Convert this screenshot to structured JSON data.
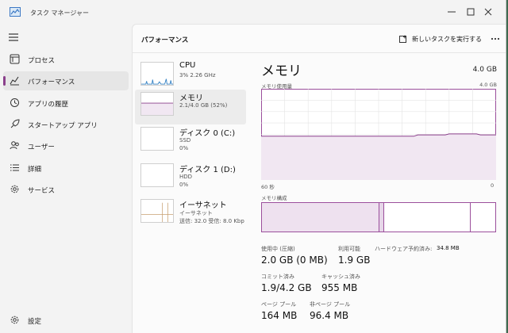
{
  "app": {
    "title": "タスク マネージャー"
  },
  "nav": {
    "items": [
      {
        "label": "プロセス",
        "icon": "process-grid-icon"
      },
      {
        "label": "パフォーマンス",
        "icon": "performance-icon",
        "active": true
      },
      {
        "label": "アプリの履歴",
        "icon": "history-icon"
      },
      {
        "label": "スタートアップ アプリ",
        "icon": "startup-icon"
      },
      {
        "label": "ユーザー",
        "icon": "users-icon"
      },
      {
        "label": "詳細",
        "icon": "details-list-icon"
      },
      {
        "label": "サービス",
        "icon": "services-gear-icon"
      }
    ],
    "settings_label": "設定"
  },
  "header": {
    "title": "パフォーマンス",
    "run_task_label": "新しいタスクを実行する"
  },
  "devices": [
    {
      "name": "CPU",
      "sub1": "3%  2.26 GHz",
      "sub2": "",
      "sub3": ""
    },
    {
      "name": "メモリ",
      "sub1": "2.1/4.0 GB (52%)",
      "sub2": "",
      "sub3": ""
    },
    {
      "name": "ディスク 0 (C:)",
      "sub1": "SSD",
      "sub2": "0%",
      "sub3": ""
    },
    {
      "name": "ディスク 1 (D:)",
      "sub1": "HDD",
      "sub2": "0%",
      "sub3": ""
    },
    {
      "name": "イーサネット",
      "sub1": "イーサネット",
      "sub2": "送信: 32.0  受信: 8.0 Kbp",
      "sub3": ""
    }
  ],
  "detail": {
    "title": "メモリ",
    "total": "4.0 GB",
    "usage_label": "メモリ使用量",
    "usage_max": "4.0 GB",
    "time_left": "60 秒",
    "time_right": "0",
    "composition_label": "メモリ構成",
    "usage_fraction": 0.52,
    "composition": {
      "in_use": 0.5,
      "modified": 0.02,
      "standby": 0.37,
      "free": 0.11
    }
  },
  "stats": {
    "in_use_label": "使用中 (圧縮)",
    "in_use_value": "2.0 GB (0 MB)",
    "available_label": "利用可能",
    "available_value": "1.9 GB",
    "hw_reserved_label": "ハードウェア予約済み:",
    "hw_reserved_value": "34.8 MB",
    "committed_label": "コミット済み",
    "committed_value": "1.9/4.2 GB",
    "cached_label": "キャッシュ済み",
    "cached_value": "955 MB",
    "paged_label": "ページ プール",
    "paged_value": "164 MB",
    "nonpaged_label": "非ページ プール",
    "nonpaged_value": "96.4 MB"
  },
  "colors": {
    "accent": "#8a3f8b",
    "memory_fill": "#f1e7f2",
    "window_bg": "#f3f3f3"
  }
}
